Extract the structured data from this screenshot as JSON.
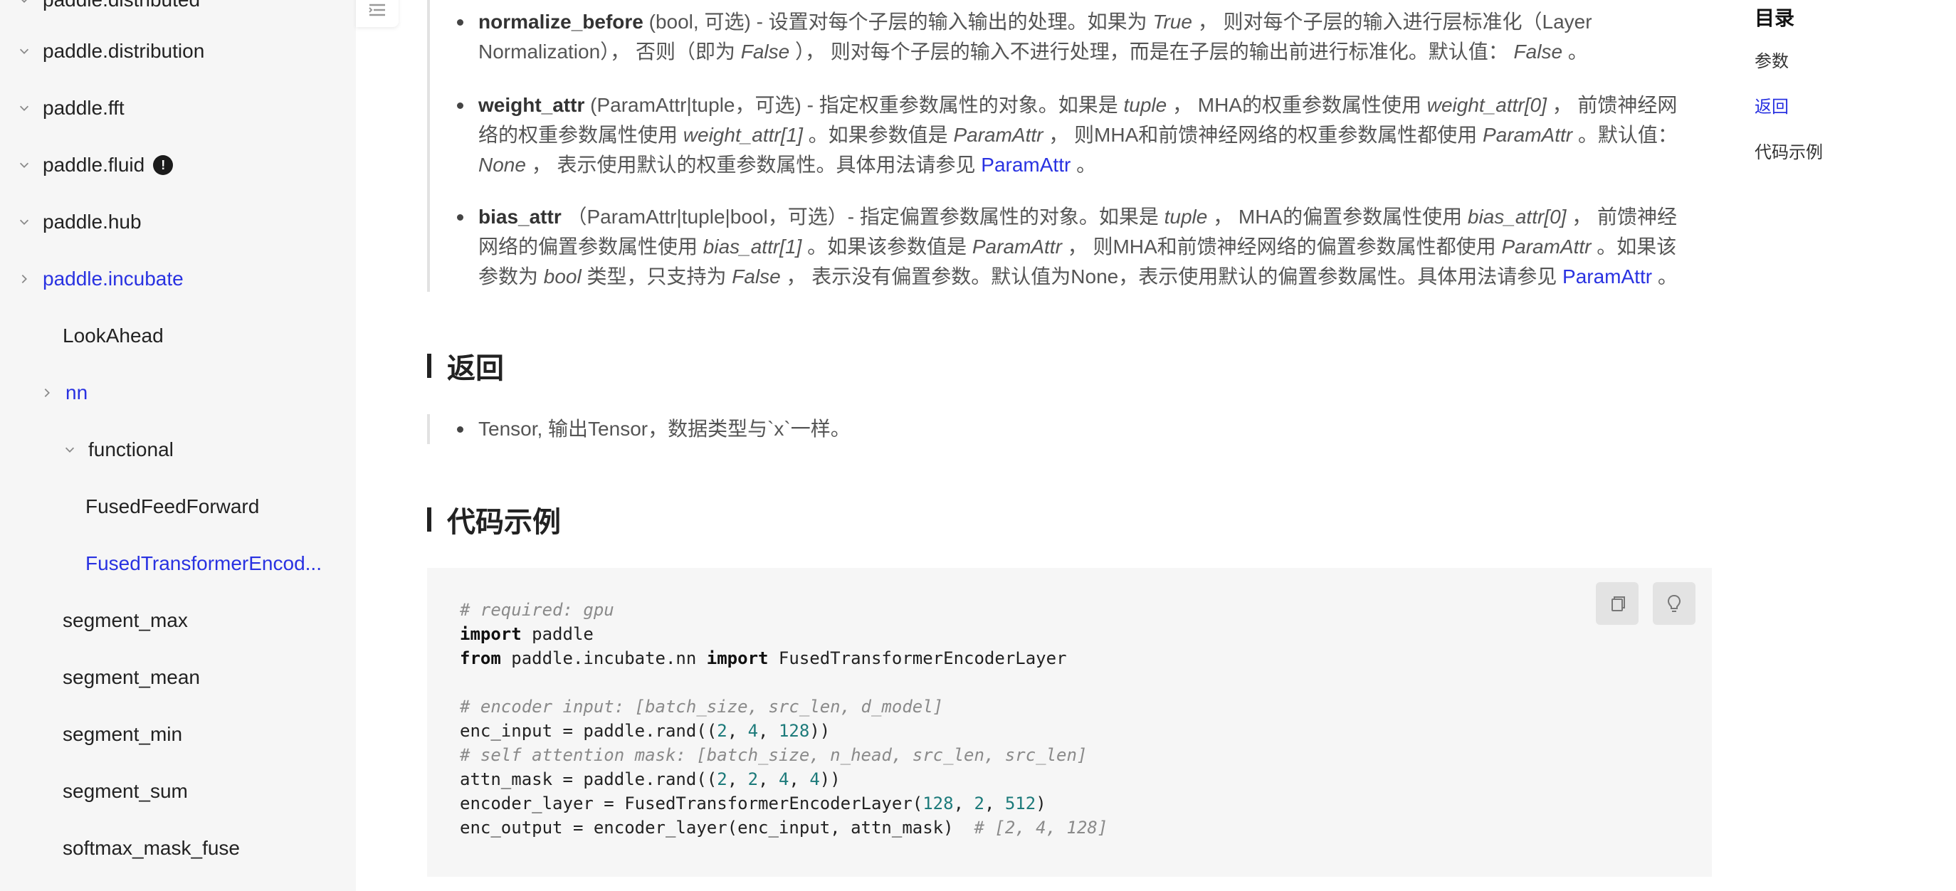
{
  "sidebar": {
    "items": [
      {
        "label": "paddle.distributed",
        "expanded": true
      },
      {
        "label": "paddle.distribution",
        "expanded": true
      },
      {
        "label": "paddle.fft",
        "expanded": true
      },
      {
        "label": "paddle.fluid",
        "expanded": true,
        "badge": "!"
      },
      {
        "label": "paddle.hub",
        "expanded": true
      },
      {
        "label": "paddle.incubate",
        "expanded": false,
        "active": true
      },
      {
        "label": "LookAhead"
      },
      {
        "label": "nn",
        "expanded": false,
        "active": true
      },
      {
        "label": "functional",
        "expanded": true
      },
      {
        "label": "FusedFeedForward"
      },
      {
        "label": "FusedTransformerEncod...",
        "active": true
      },
      {
        "label": "segment_max"
      },
      {
        "label": "segment_mean"
      },
      {
        "label": "segment_min"
      },
      {
        "label": "segment_sum"
      },
      {
        "label": "softmax_mask_fuse"
      }
    ]
  },
  "params": {
    "normalize_before": {
      "name": "normalize_before",
      "t1": " (bool, 可选) - 设置对每个子层的输入输出的处理。如果为 ",
      "e1": "True",
      "t2": " ， 则对每个子层的输入进行层标准化（Layer Normalization）， 否则（即为 ",
      "e2": "False",
      "t3": " ）， 则对每个子层的输入不进行处理，而是在子层的输出前进行标准化。默认值： ",
      "e3": "False",
      "t4": " 。"
    },
    "weight_attr": {
      "name": "weight_attr",
      "t1": " (ParamAttr|tuple，可选) - 指定权重参数属性的对象。如果是 ",
      "e1": "tuple",
      "t2": " ， MHA的权重参数属性使用 ",
      "e2": "weight_attr[0]",
      "t3": " ， 前馈神经网络的权重参数属性使用 ",
      "e3": "weight_attr[1]",
      "t4": " 。如果参数值是 ",
      "e4": "ParamAttr",
      "t5": " ， 则MHA和前馈神经网络的权重参数属性都使用 ",
      "e5": "ParamAttr",
      "t6": " 。默认值：",
      "e6": "None",
      "t7": " ， 表示使用默认的权重参数属性。具体用法请参见 ",
      "link": "ParamAttr",
      "t8": " 。"
    },
    "bias_attr": {
      "name": "bias_attr",
      "t1": " （ParamAttr|tuple|bool，可选）- 指定偏置参数属性的对象。如果是 ",
      "e1": "tuple",
      "t2": " ， MHA的偏置参数属性使用 ",
      "e2": "bias_attr[0]",
      "t3": " ， 前馈神经网络的偏置参数属性使用 ",
      "e3": "bias_attr[1]",
      "t4": " 。如果该参数值是 ",
      "e4": "ParamAttr",
      "t5": " ， 则MHA和前馈神经网络的偏置参数属性都使用 ",
      "e5": "ParamAttr",
      "t6": " 。如果该参数为 ",
      "e6": "bool",
      "t7": " 类型，只支持为 ",
      "e7": "False",
      "t8": " ， 表示没有偏置参数。默认值为None，表示使用默认的偏置参数属性。具体用法请参见 ",
      "link": "ParamAttr",
      "t9": " 。"
    }
  },
  "returns": {
    "title": "返回",
    "text": "Tensor, 输出Tensor，数据类型与`x`一样。"
  },
  "example": {
    "title": "代码示例",
    "code": {
      "c1": "# required: gpu",
      "kw_import": "import",
      "l2": " paddle",
      "kw_from": "from",
      "l3a": " paddle.incubate.nn ",
      "l3b": " FusedTransformerEncoderLayer",
      "c2": "# encoder input: [batch_size, src_len, d_model]",
      "l5a": "enc_input = paddle.rand((",
      "n2": "2",
      "n4": "4",
      "n128": "128",
      "l5z": "))",
      "c3": "# self attention mask: [batch_size, n_head, src_len, src_len]",
      "l7a": "attn_mask = paddle.rand((",
      "l8a": "encoder_layer = FusedTransformerEncoderLayer(",
      "n512": "512",
      "close1": ")",
      "sep": ", ",
      "l9": "enc_output = encoder_layer(enc_input, attn_mask)  ",
      "c4": "# [2, 4, 128]"
    }
  },
  "toc": {
    "title": "目录",
    "items": [
      "参数",
      "返回",
      "代码示例"
    ],
    "active": "返回"
  },
  "icons": {
    "toggle": "toc-toggle-icon",
    "copy": "copy-icon",
    "hint": "lightbulb-icon",
    "expand": "chevron-down-icon",
    "collapse": "chevron-right-icon",
    "info": "exclamation-badge-icon"
  },
  "colors": {
    "link": "#2932e1",
    "sidebar_bg": "#f6f6f6",
    "code_bg": "#f6f6f6",
    "number": "#1c7a7a",
    "comment": "#8a8a8a"
  }
}
